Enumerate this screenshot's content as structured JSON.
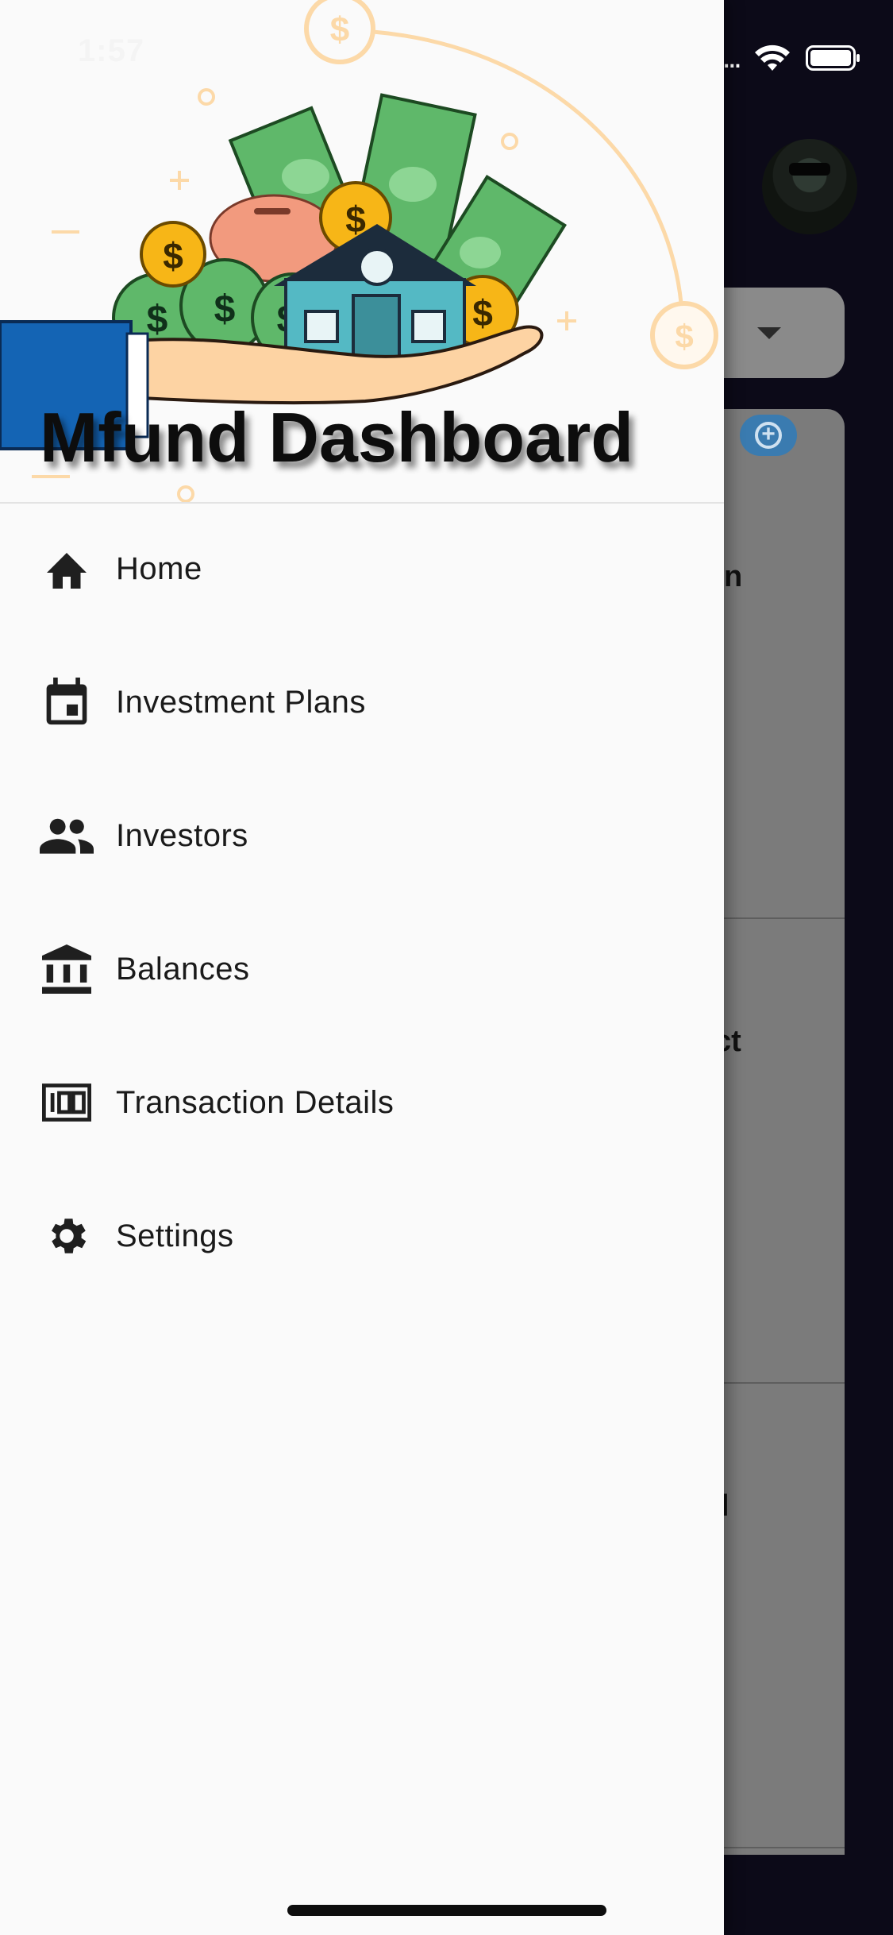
{
  "status_bar": {
    "time": "1:57",
    "signal": "..."
  },
  "drawer": {
    "title": "Mfund Dashboard",
    "menu": [
      {
        "label": "Home",
        "icon": "home-icon"
      },
      {
        "label": "Investment Plans",
        "icon": "calendar-event-icon"
      },
      {
        "label": "Investors",
        "icon": "people-icon"
      },
      {
        "label": "Balances",
        "icon": "bank-icon"
      },
      {
        "label": "Transaction Details",
        "icon": "counter-100-icon"
      },
      {
        "label": "Settings",
        "icon": "gear-icon"
      }
    ]
  },
  "background_app": {
    "partial_texts": [
      "n",
      "ct",
      "l"
    ]
  },
  "colors": {
    "drawer_bg": "#fafafa",
    "scrim_bg": "#0c0a18",
    "text": "#1a1a1a",
    "accent_blue": "#3a7bb0"
  }
}
